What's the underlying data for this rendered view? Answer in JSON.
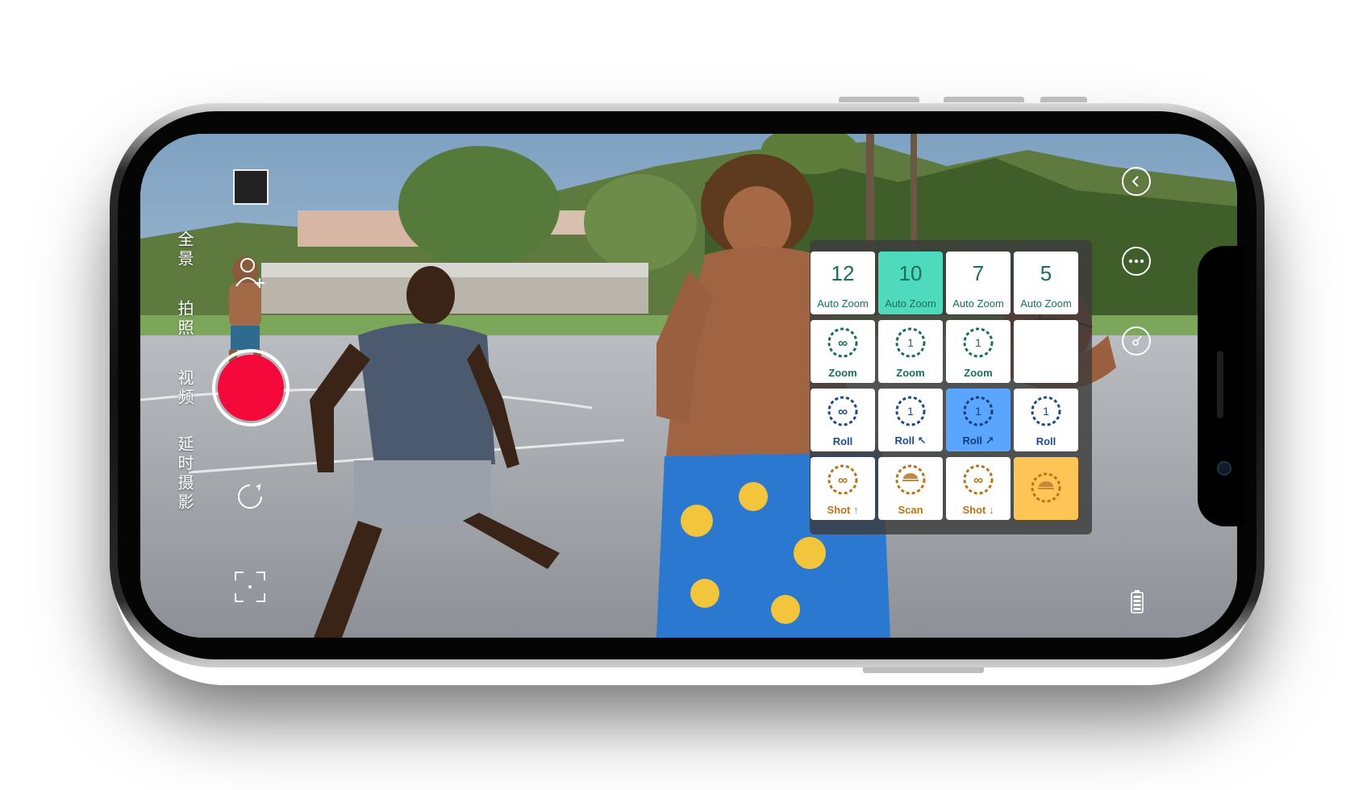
{
  "camera_modes": {
    "panorama": "全景",
    "photo": "拍照",
    "video": "视频",
    "timelapse": "延时摄影"
  },
  "icons": {
    "qr": "qr-code-icon",
    "add_person": "add-person-icon",
    "timer": "timer-icon",
    "focus": "focus-frame-icon",
    "back": "back-icon",
    "more": "more-icon",
    "gimbal": "gimbal-icon",
    "battery": "battery-icon"
  },
  "colors": {
    "record": "#f5093a",
    "active_teal": "#4edbbd",
    "active_blue": "#5aa6ff",
    "active_orange": "#ffc456",
    "green_text": "#1c6e5c",
    "blue_text": "#1a4b8c",
    "gold_text": "#b8741a"
  },
  "panel": {
    "row1": [
      {
        "number": "12",
        "label": "Auto Zoom",
        "selected": false
      },
      {
        "number": "10",
        "label": "Auto Zoom",
        "selected": true
      },
      {
        "number": "7",
        "label": "Auto Zoom",
        "selected": false
      },
      {
        "number": "5",
        "label": "Auto Zoom",
        "selected": false
      }
    ],
    "row2": [
      {
        "glyph": "∞",
        "label": "Zoom"
      },
      {
        "glyph": "1",
        "label": "Zoom"
      },
      {
        "glyph": "1",
        "label": "Zoom"
      },
      {
        "glyph": "",
        "label": ""
      }
    ],
    "row3": [
      {
        "glyph": "∞",
        "label": "Roll",
        "selected": false
      },
      {
        "glyph": "1",
        "label": "Roll ↖",
        "selected": false
      },
      {
        "glyph": "1",
        "label": "Roll ↗",
        "selected": true
      },
      {
        "glyph": "1",
        "label": "Roll",
        "selected": false
      }
    ],
    "row4": [
      {
        "glyph": "∞",
        "label": "Shot ↑",
        "selected": false
      },
      {
        "glyph": "",
        "label": "Scan",
        "selected": false
      },
      {
        "glyph": "∞",
        "label": "Shot ↓",
        "selected": false
      },
      {
        "glyph": "",
        "label": "",
        "selected": true
      }
    ]
  }
}
